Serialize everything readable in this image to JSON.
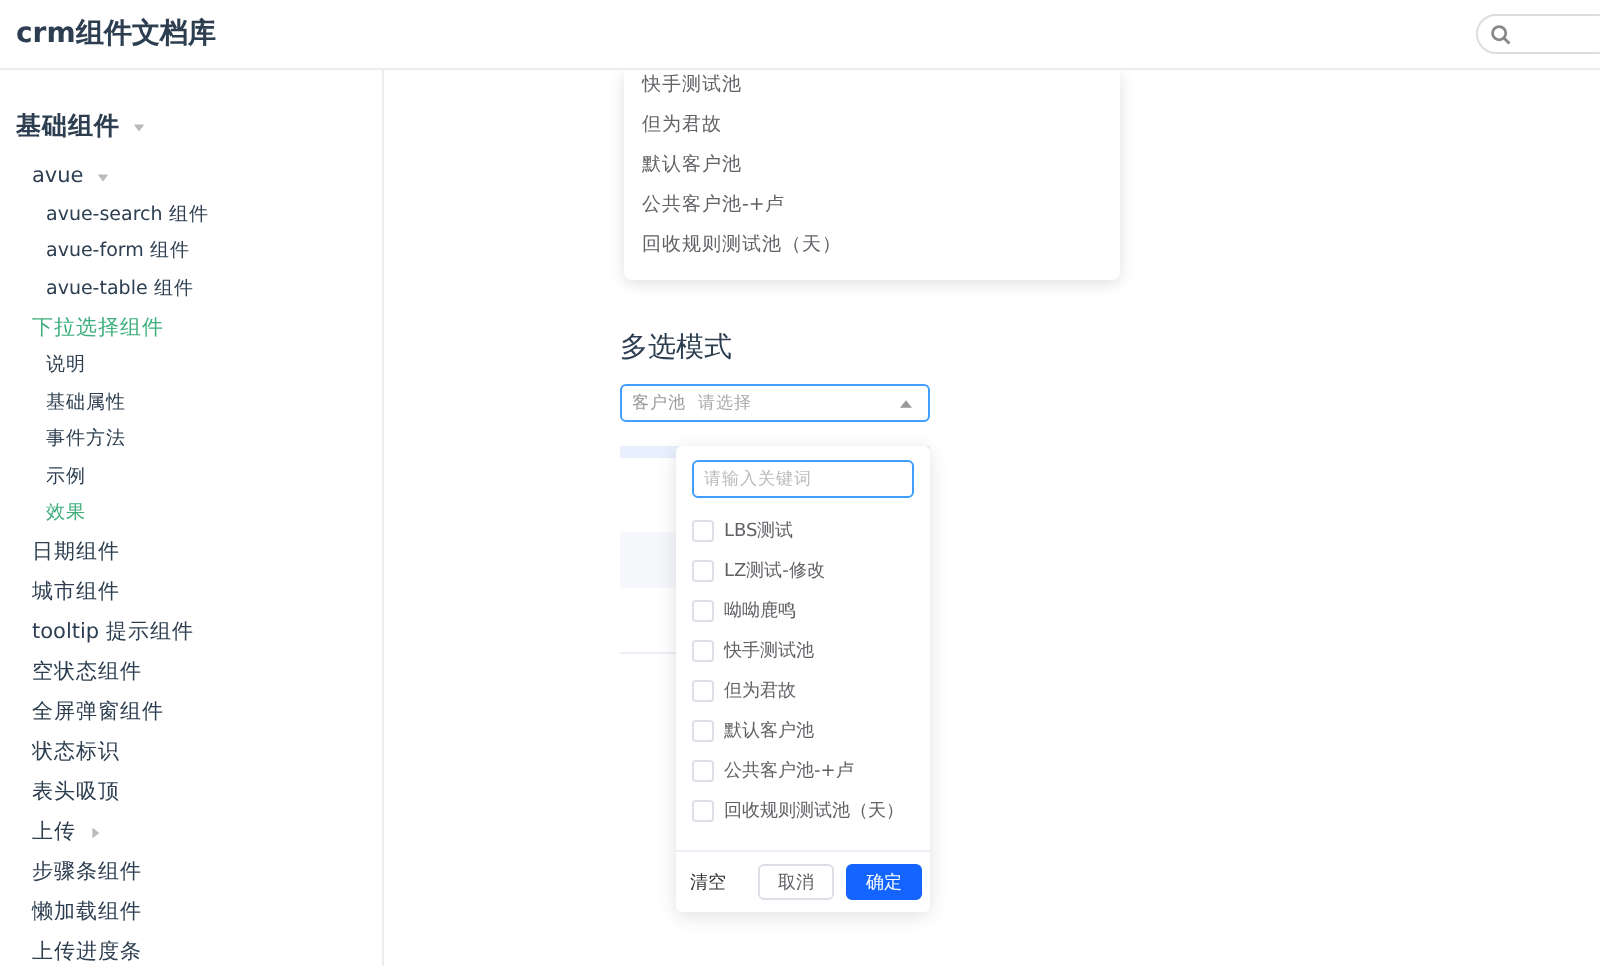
{
  "header": {
    "title": "crm组件文档库"
  },
  "sidebar": {
    "groups": [
      {
        "label": "基础组件",
        "expanded": true,
        "children": [
          {
            "label": "avue",
            "expanded": true,
            "selected": false,
            "children": [
              {
                "label": "avue-search 组件",
                "selected": false
              },
              {
                "label": "avue-form 组件",
                "selected": false
              },
              {
                "label": "avue-table 组件",
                "selected": false
              }
            ]
          },
          {
            "label": "下拉选择组件",
            "selected": true,
            "children": [
              {
                "label": "说明",
                "selected": false
              },
              {
                "label": "基础属性",
                "selected": false
              },
              {
                "label": "事件方法",
                "selected": false
              },
              {
                "label": "示例",
                "selected": false
              },
              {
                "label": "效果",
                "selected": true
              }
            ]
          },
          {
            "label": "日期组件",
            "selected": false
          },
          {
            "label": "城市组件",
            "selected": false
          },
          {
            "label": "tooltip 提示组件",
            "selected": false
          },
          {
            "label": "空状态组件",
            "selected": false
          },
          {
            "label": "全屏弹窗组件",
            "selected": false
          },
          {
            "label": "状态标识",
            "selected": false
          },
          {
            "label": "表头吸顶",
            "selected": false
          },
          {
            "label": "上传",
            "expanded": false,
            "selected": false
          },
          {
            "label": "步骤条组件",
            "selected": false
          },
          {
            "label": "懒加载组件",
            "selected": false
          },
          {
            "label": "上传进度条",
            "selected": false
          }
        ]
      }
    ]
  },
  "upper_dropdown": {
    "options": [
      "快手测试池",
      "但为君故",
      "默认客户池",
      "公共客户池-+卢",
      "回收规则测试池（天）"
    ]
  },
  "section": {
    "title": "多选模式",
    "select": {
      "label": "客户池",
      "placeholder": "请选择",
      "open": true
    },
    "dropdown": {
      "search_placeholder": "请输入关键词",
      "options": [
        {
          "label": "LBS测试",
          "checked": false
        },
        {
          "label": "LZ测试-修改",
          "checked": false
        },
        {
          "label": "呦呦鹿鸣",
          "checked": false
        },
        {
          "label": "快手测试池",
          "checked": false
        },
        {
          "label": "但为君故",
          "checked": false
        },
        {
          "label": "默认客户池",
          "checked": false
        },
        {
          "label": "公共客户池-+卢",
          "checked": false
        },
        {
          "label": "回收规则测试池（天）",
          "checked": false
        }
      ],
      "buttons": [
        {
          "label": "清空",
          "kind": "text"
        },
        {
          "label": "取消",
          "kind": "default"
        },
        {
          "label": "确定",
          "kind": "primary"
        }
      ]
    }
  }
}
